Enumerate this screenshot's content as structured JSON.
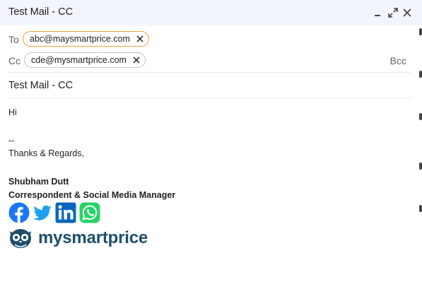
{
  "window": {
    "title": "Test Mail - CC",
    "minimize_icon": "minimize-icon",
    "expand_icon": "expand-icon",
    "close_icon": "close-icon"
  },
  "recipients": {
    "to_label": "To",
    "to_chip": "abc@maysmartprice.com",
    "cc_label": "Cc",
    "cc_chip": "cde@mysmartprice.com",
    "bcc_label": "Bcc"
  },
  "subject": "Test Mail - CC",
  "body": {
    "greeting": "Hi",
    "separator": "--",
    "closing": "Thanks & Regards,",
    "name": "Shubham Dutt",
    "role": "Correspondent & Social Media Manager"
  },
  "signature": {
    "social_icons": [
      "facebook-icon",
      "twitter-icon",
      "linkedin-icon",
      "whatsapp-icon"
    ],
    "brand_name": "mysmartprice"
  },
  "colors": {
    "titlebar": "#f2f6fc",
    "to_chip_border": "#e8a33d",
    "facebook": "#1877f2",
    "twitter": "#1da1f2",
    "linkedin": "#0a66c2",
    "whatsapp": "#25d366",
    "brand": "#1e4f6b"
  }
}
